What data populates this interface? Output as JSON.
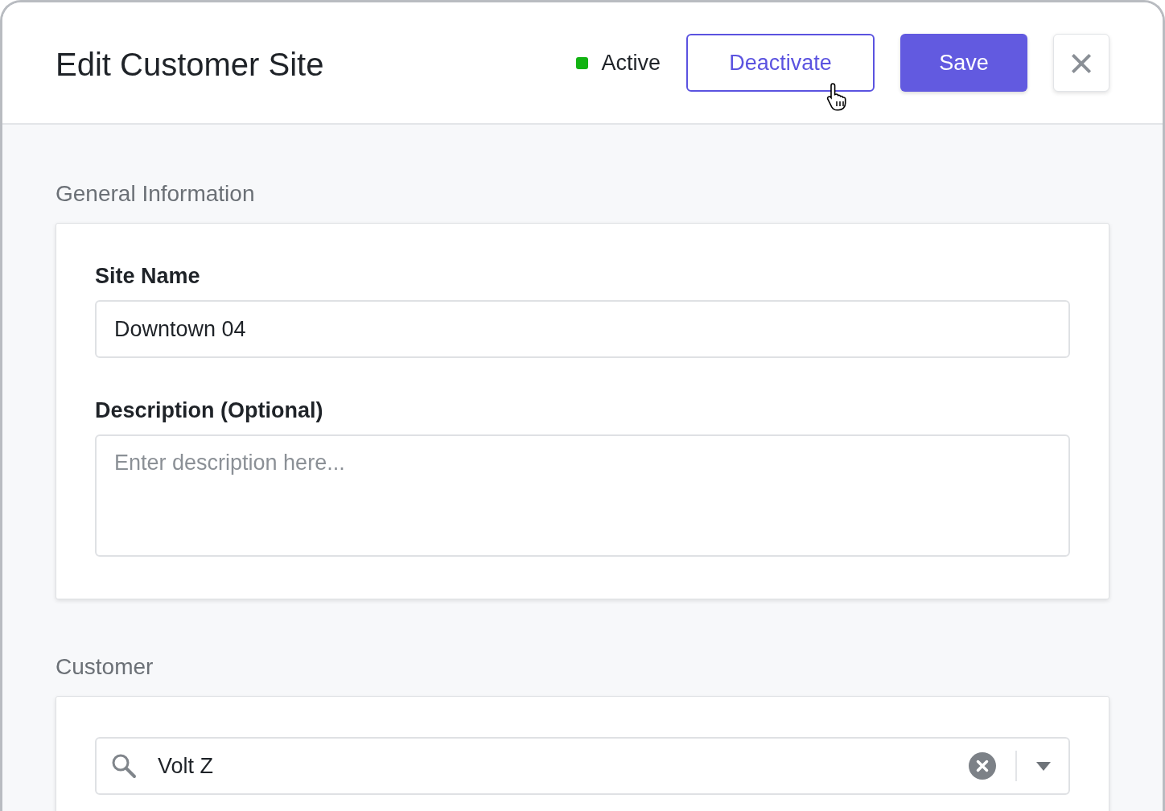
{
  "header": {
    "title": "Edit Customer Site",
    "status": {
      "label": "Active",
      "color": "#12b312"
    },
    "buttons": [
      {
        "kind": "outline",
        "label": "Deactivate"
      },
      {
        "kind": "primary",
        "label": "Save"
      },
      {
        "kind": "close",
        "label": "×"
      }
    ]
  },
  "sections": [
    {
      "title": "General Information",
      "fields": [
        {
          "kind": "text",
          "label": "Site Name",
          "value": "Downtown 04"
        },
        {
          "kind": "textarea",
          "label": "Description (Optional)",
          "placeholder": "Enter description here..."
        }
      ]
    },
    {
      "title": "Customer",
      "fields": [
        {
          "kind": "search-select",
          "value": "Volt Z"
        }
      ]
    }
  ]
}
